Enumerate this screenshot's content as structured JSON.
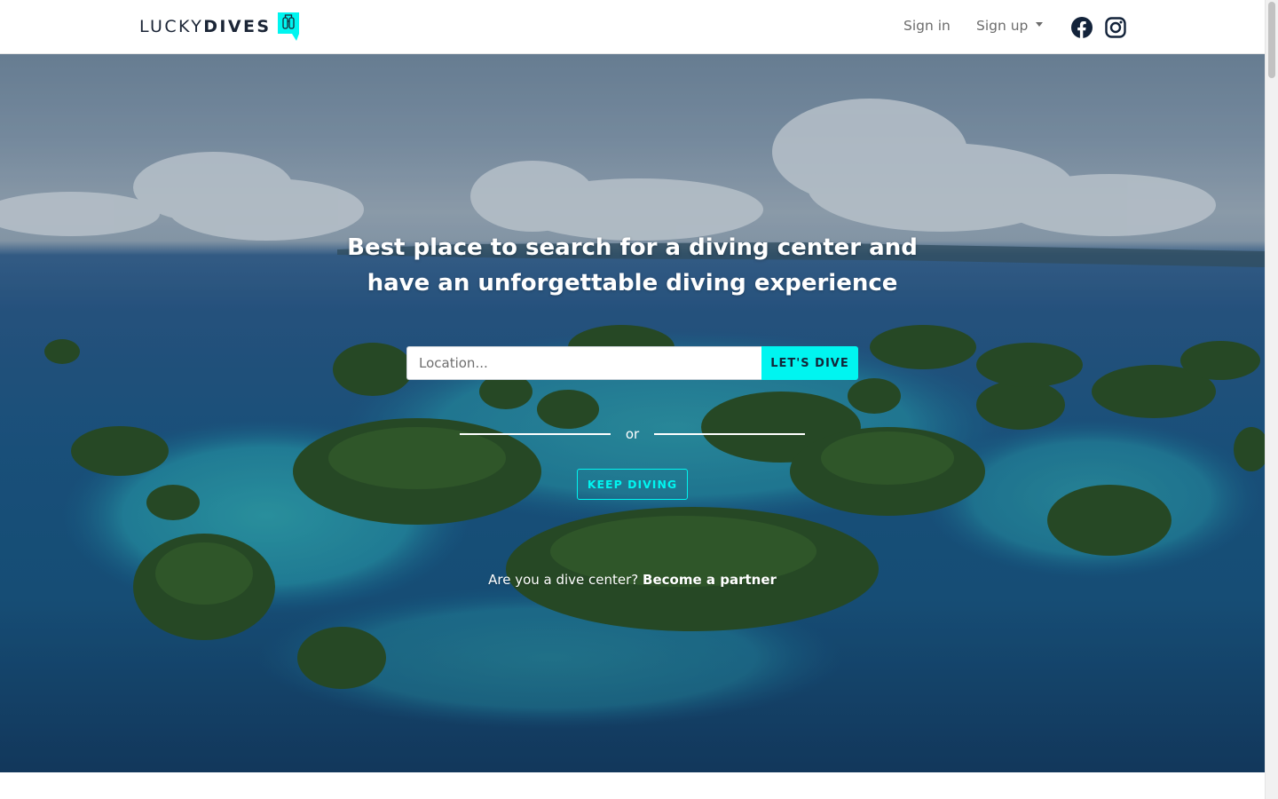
{
  "navbar": {
    "brand_light": "LUCKY",
    "brand_bold": "DIVES",
    "logo_icon": "dive-tank-speech-bubble-icon",
    "sign_in": "Sign in",
    "sign_up": "Sign up",
    "social_icons": [
      "facebook-icon",
      "instagram-icon"
    ]
  },
  "hero": {
    "headline": "Best place to search for a diving center and have an unforgettable diving experience",
    "search": {
      "placeholder": "Location...",
      "value": "",
      "button": "LET'S DIVE"
    },
    "divider_text": "or",
    "keep_diving": "KEEP DIVING",
    "partner_prompt": "Are you a dive center?",
    "partner_link": "Become a partner"
  },
  "colors": {
    "accent": "#00f5f0",
    "brand_dark": "#1b2536",
    "nav_text": "#6c6c6c",
    "white": "#ffffff"
  }
}
